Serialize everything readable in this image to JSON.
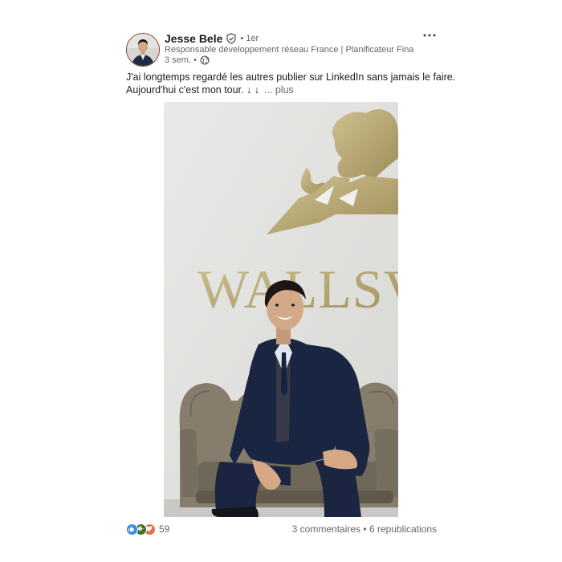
{
  "author": {
    "name": "Jesse Bele",
    "degree": "• 1er",
    "headline": "Responsable développement réseau France | Planificateur Finan...",
    "time": "3 sem. •"
  },
  "post": {
    "line1": "J'ai longtemps regardé les autres publier sur LinkedIn sans jamais le faire.",
    "line2": "Aujourd'hui c'est mon tour. ↓ ↓",
    "see_more": "... plus"
  },
  "photo": {
    "sign_text": "WALLSV"
  },
  "social": {
    "reaction_count": "59",
    "comments": "3 commentaires",
    "separator": "•",
    "reposts": "6 republications"
  },
  "colors": {
    "like": "#378fe9",
    "celebrate": "#44712e",
    "love": "#df704d"
  },
  "icons": [
    "verified-icon",
    "globe-icon",
    "more-icon",
    "like-icon",
    "celebrate-icon",
    "love-icon"
  ]
}
